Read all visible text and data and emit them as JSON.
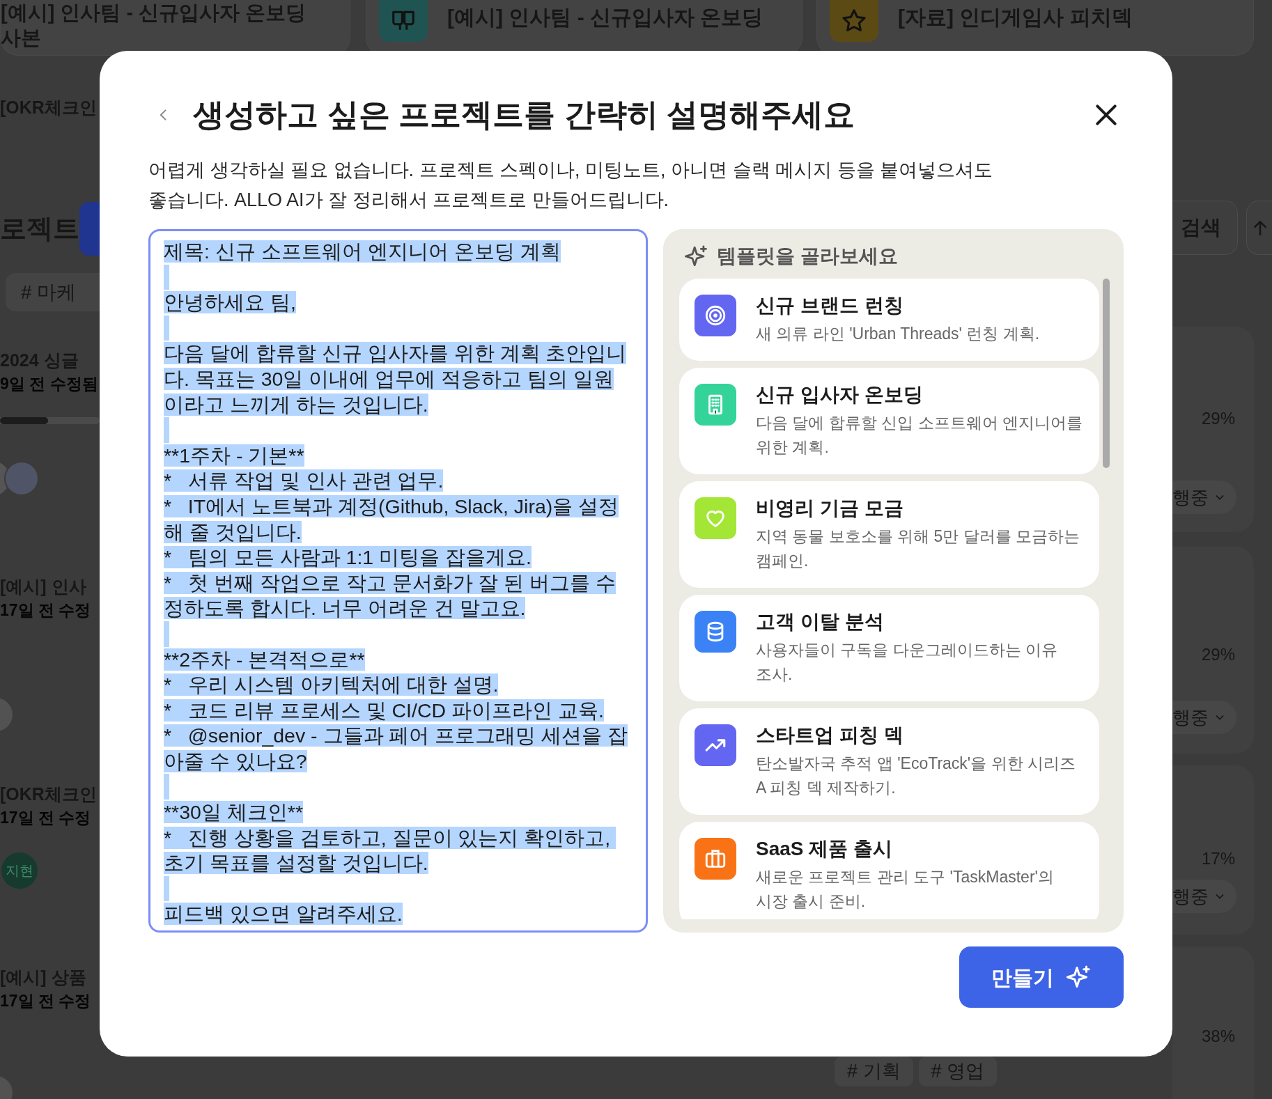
{
  "background": {
    "top_cards": [
      {
        "kind": "text",
        "title": "[예시] 인사팀 - 신규입사자 온보딩 사본"
      },
      {
        "kind": "icon",
        "color": "#1f5452",
        "title": "[예시] 인사팀 - 신규입사자 온보딩"
      },
      {
        "kind": "icon",
        "color": "#5c4a14",
        "title": "[자료] 인디게임사 피치덱"
      }
    ],
    "left_items": [
      {
        "kind": "heading",
        "text": "[OKR체크인"
      },
      {
        "kind": "section",
        "text": "로젝트"
      },
      {
        "kind": "tag",
        "text": "# 마케"
      },
      {
        "kind": "project",
        "title": "2024 싱글",
        "meta": "9일 전 수정됨"
      },
      {
        "kind": "progress",
        "level": 0.48
      },
      {
        "kind": "avatars"
      },
      {
        "kind": "project",
        "title": "[예시] 인사",
        "meta": "17일 전 수정"
      },
      {
        "kind": "circle"
      },
      {
        "kind": "project",
        "title": "[OKR체크인",
        "meta": "17일 전 수정"
      },
      {
        "kind": "avatar",
        "label": "지현"
      },
      {
        "kind": "project",
        "title": "[예시] 상품",
        "meta": "17일 전 수정"
      },
      {
        "kind": "circle"
      }
    ],
    "search_button": "검색",
    "panels": [
      {
        "percent": "29%",
        "status": "행중"
      },
      {
        "percent": "29%",
        "status": "행중"
      },
      {
        "percent": "17%",
        "status": "행중"
      },
      {
        "percent": "38%"
      }
    ],
    "bottom_tags": [
      "# 기획",
      "# 영업"
    ]
  },
  "dialog": {
    "title": "생성하고 싶은 프로젝트를 간략히 설명해주세요",
    "description": "어렵게 생각하실 필요 없습니다. 프로젝트 스펙이나, 미팅노트, 아니면 슬랙 메시지 등을 붙여넣으셔도 좋습니다. ALLO AI가 잘 정리해서 프로젝트로 만들어드립니다.",
    "field": {
      "selected": true,
      "paragraphs": [
        [
          "제목: 신규 소프트웨어 엔지니어 온보딩 계획"
        ],
        [
          "안녕하세요 팀,"
        ],
        [
          "다음 달에 합류할 신규 입사자를 위한 계획 초안입니다. 목표는 30일 이내에 업무에 적응하고 팀의 일원이라고 느끼게 하는 것입니다."
        ],
        [
          "**1주차 - 기본**",
          "*   서류 작업 및 인사 관련 업무.",
          "*   IT에서 노트북과 계정(Github, Slack, Jira)을 설정해 줄 것입니다.",
          "*   팀의 모든 사람과 1:1 미팅을 잡을게요.",
          "*   첫 번째 작업으로 작고 문서화가 잘 된 버그를 수정하도록 합시다. 너무 어려운 건 말고요."
        ],
        [
          "**2주차 - 본격적으로**",
          "*   우리 시스템 아키텍처에 대한 설명.",
          "*   코드 리뷰 프로세스 및 CI/CD 파이프라인 교육.",
          "*   @senior_dev - 그들과 페어 프로그래밍 세션을 잡아줄 수 있나요?"
        ],
        [
          "**30일 체크인**",
          "*   진행 상황을 검토하고, 질문이 있는지 확인하고, 초기 목표를 설정할 것입니다."
        ],
        [
          "피드백 있으면 알려주세요."
        ]
      ]
    },
    "templates_heading": "템플릿을 골라보세요",
    "templates": [
      {
        "title": "신규 브랜드 런칭",
        "description": "새 의류 라인 'Urban Threads' 런칭 계획.",
        "color": "#6366f1"
      },
      {
        "title": "신규 입사자 온보딩",
        "description": "다음 달에 합류할 신입 소프트웨어 엔지니어를 위한 계획.",
        "color": "#34d399"
      },
      {
        "title": "비영리 기금 모금",
        "description": "지역 동물 보호소를 위해 5만 달러를 모금하는 캠페인.",
        "color": "#a3e635"
      },
      {
        "title": "고객 이탈 분석",
        "description": "사용자들이 구독을 다운그레이드하는 이유 조사.",
        "color": "#3b82f6"
      },
      {
        "title": "스타트업 피칭 덱",
        "description": "탄소발자국 추적 앱 'EcoTrack'을 위한 시리즈 A 피칭 덱 제작하기.",
        "color": "#6366f1"
      },
      {
        "title": "SaaS 제품 출시",
        "description": "새로운 프로젝트 관리 도구 'TaskMaster'의 시장 출시 준비.",
        "color": "#f97316"
      }
    ],
    "create_button": "만들기"
  }
}
